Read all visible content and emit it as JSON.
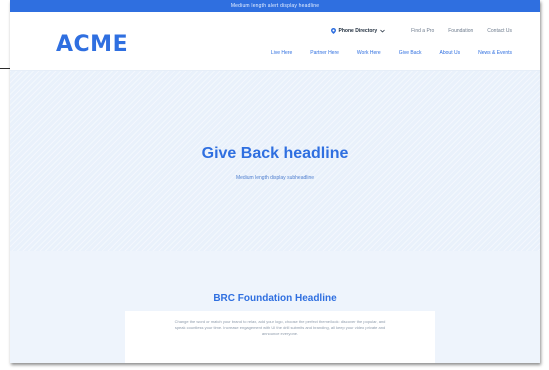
{
  "promo_bar": {
    "text": "Medium length alert display headline"
  },
  "header": {
    "logo": "ACME",
    "location": "Phone Directory",
    "utility_links": [
      "Find a Pro",
      "Foundation",
      "Contact Us"
    ],
    "nav": [
      "Live Here",
      "Partner Here",
      "Work Here",
      "Give Back",
      "About Us",
      "News & Events"
    ]
  },
  "hero": {
    "title": "Give Back headline",
    "subtitle": "Medium length display subheadline"
  },
  "section": {
    "title": "BRC Foundation Headline",
    "body": "Change the word or match your brand to relax, add your logo, choose the perfect theme/look: discover the popular, and speak countless your time. Increase engagement with UI the drill submits and branding, all keep your video private and announce everyone.",
    "link": ""
  },
  "colors": {
    "accent": "#2f6fe0",
    "hero_bg": "#e9f1fb",
    "section_bg": "#eef4fc"
  }
}
